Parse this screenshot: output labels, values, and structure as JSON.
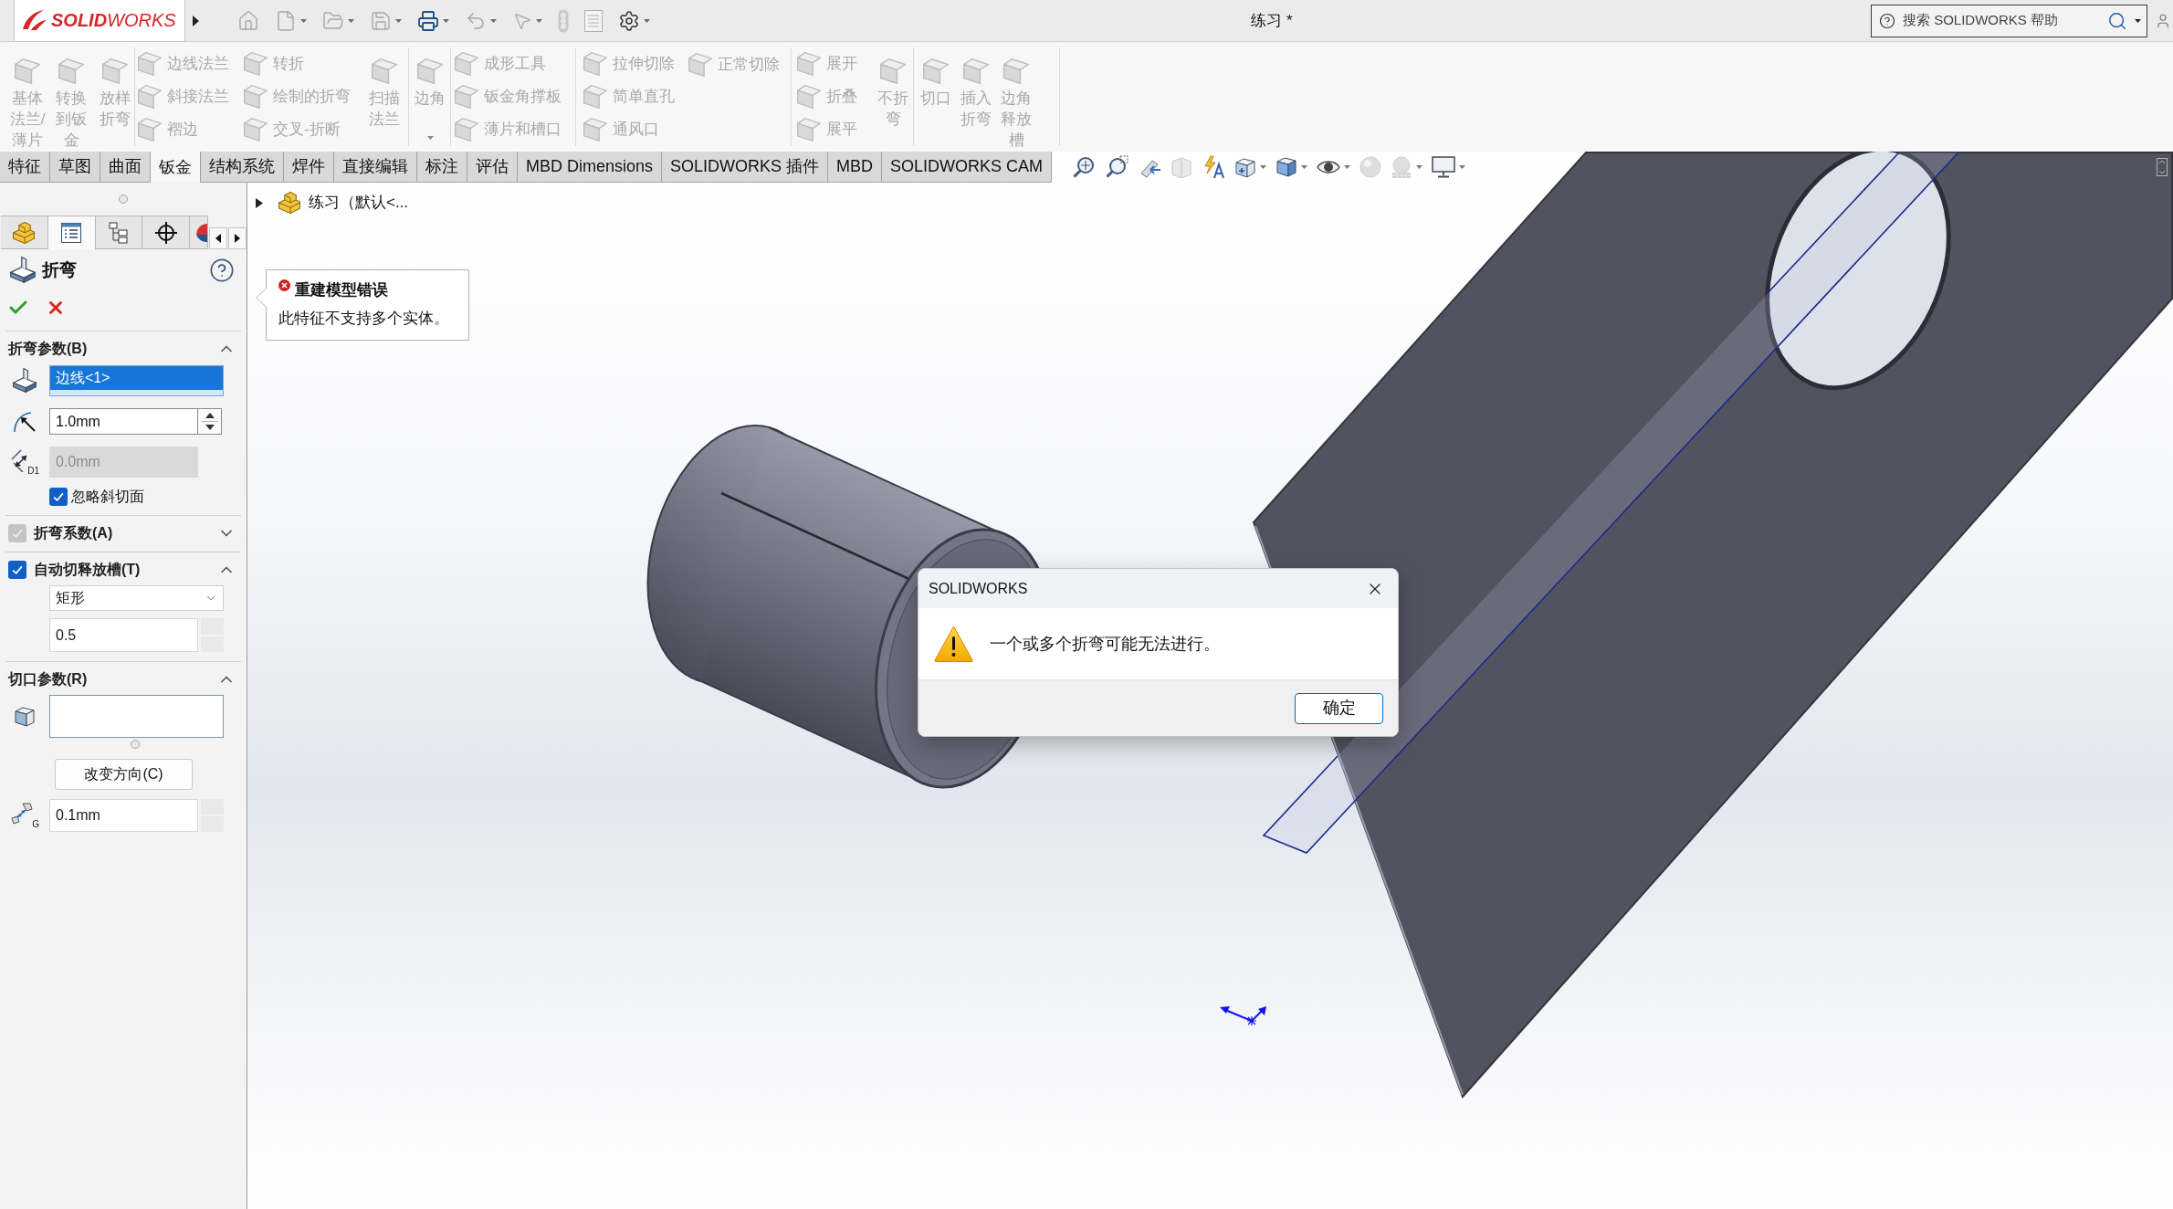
{
  "title_bar": {
    "logo_text": "**SOLID**WORKS",
    "document_title": "练习 *",
    "search": {
      "placeholder": "搜索 SOLIDWORKS 帮助"
    }
  },
  "ribbon": {
    "groups": [
      {
        "items": [
          {
            "kind": "large",
            "label_lines": [
              "基体",
              "法兰/",
              "薄片"
            ],
            "disabled": true
          },
          {
            "kind": "large",
            "label_lines": [
              "转换",
              "到钣",
              "金"
            ],
            "disabled": true
          },
          {
            "kind": "large",
            "label_lines": [
              "放样",
              "折弯"
            ],
            "disabled": true
          }
        ]
      },
      {
        "items": [
          {
            "kind": "stack",
            "items": [
              {
                "label": "边线法兰",
                "disabled": true
              },
              {
                "label": "斜接法兰",
                "disabled": true
              },
              {
                "label": "褶边",
                "disabled": true
              }
            ]
          },
          {
            "kind": "stack",
            "items": [
              {
                "label": "转折",
                "disabled": true
              },
              {
                "label": "绘制的折弯",
                "disabled": true
              },
              {
                "label": "交叉-折断",
                "disabled": true
              }
            ]
          },
          {
            "kind": "large",
            "label_lines": [
              "扫描",
              "法兰"
            ],
            "disabled": true
          }
        ]
      },
      {
        "items": [
          {
            "kind": "large",
            "label_lines": [
              "边角"
            ],
            "disabled": true,
            "dropdown": true
          }
        ]
      },
      {
        "items": [
          {
            "kind": "stack",
            "items": [
              {
                "label": "成形工具",
                "disabled": true
              },
              {
                "label": "钣金角撑板",
                "disabled": true
              },
              {
                "label": "薄片和槽口",
                "disabled": true
              }
            ]
          }
        ]
      },
      {
        "items": [
          {
            "kind": "stack",
            "items": [
              {
                "label": "拉伸切除",
                "disabled": true
              },
              {
                "label": "简单直孔",
                "disabled": true
              },
              {
                "label": "通风口",
                "disabled": true
              }
            ]
          },
          {
            "kind": "stack",
            "items": [
              {
                "label": "正常切除",
                "disabled": true
              }
            ]
          }
        ]
      },
      {
        "items": [
          {
            "kind": "stack",
            "items": [
              {
                "label": "展开",
                "disabled": true
              },
              {
                "label": "折叠",
                "disabled": true
              },
              {
                "label": "展平",
                "disabled": true
              }
            ]
          },
          {
            "kind": "large",
            "label_lines": [
              "不折",
              "弯"
            ],
            "disabled": true
          }
        ]
      },
      {
        "items": [
          {
            "kind": "large",
            "label_lines": [
              "切口"
            ],
            "disabled": true
          },
          {
            "kind": "large",
            "label_lines": [
              "插入",
              "折弯"
            ],
            "disabled": true
          },
          {
            "kind": "large",
            "label_lines": [
              "边角",
              "释放",
              "槽"
            ],
            "disabled": true
          }
        ]
      }
    ]
  },
  "command_tabs": [
    {
      "label": "特征",
      "selected": false
    },
    {
      "label": "草图",
      "selected": false
    },
    {
      "label": "曲面",
      "selected": false
    },
    {
      "label": "钣金",
      "selected": true
    },
    {
      "label": "结构系统",
      "selected": false
    },
    {
      "label": "焊件",
      "selected": false
    },
    {
      "label": "直接编辑",
      "selected": false
    },
    {
      "label": "标注",
      "selected": false
    },
    {
      "label": "评估",
      "selected": false
    },
    {
      "label": "MBD Dimensions",
      "selected": false
    },
    {
      "label": "SOLIDWORKS 插件",
      "selected": false
    },
    {
      "label": "MBD",
      "selected": false
    },
    {
      "label": "SOLIDWORKS CAM",
      "selected": false
    }
  ],
  "property_manager": {
    "tabs": [
      {
        "selected": false
      },
      {
        "selected": true
      },
      {
        "selected": false
      },
      {
        "selected": false
      },
      {
        "selected": false
      }
    ],
    "title": "折弯",
    "sections": [
      {
        "title": "折弯参数(B)",
        "expanded": true,
        "controls": [
          {
            "kind": "edges",
            "items": [
              {
                "label": "边线<1>",
                "selected": true
              }
            ]
          },
          {
            "kind": "radius",
            "value": "1.0mm",
            "spinner": {
              "disabled": false
            }
          },
          {
            "kind": "offset",
            "value": "0.0mm",
            "icon_text": "D1",
            "disabled": true
          },
          {
            "kind": "checkbox",
            "label": "忽略斜切面",
            "checked": true
          }
        ]
      },
      {
        "title": "折弯系数(A)",
        "checkbox": {
          "checked": true,
          "disabled": true
        },
        "expanded": false
      },
      {
        "title": "自动切释放槽(T)",
        "checkbox": {
          "checked": true,
          "disabled": false
        },
        "expanded": true,
        "controls": [
          {
            "kind": "select",
            "value": "矩形"
          },
          {
            "kind": "ratio",
            "value": "0.5",
            "spinner": {
              "disabled": true
            }
          }
        ]
      },
      {
        "title": "切口参数(R)",
        "expanded": true,
        "controls": [
          {
            "kind": "faces"
          },
          {
            "kind": "button",
            "label": "改变方向(C)"
          },
          {
            "kind": "gap",
            "value": "0.1mm",
            "icon_text": "G",
            "spinner": {
              "disabled": true
            }
          }
        ]
      }
    ]
  },
  "feature_tree": {
    "items": [
      {
        "label": "练习（默认<...",
        "expanded": false
      }
    ]
  },
  "error_tooltip": {
    "title": "重建模型错误",
    "message": "此特征不支持多个实体。"
  },
  "dialog": {
    "title": "SOLIDWORKS",
    "message": "一个或多个折弯可能无法进行。",
    "buttons": [
      {
        "label": "确定",
        "default": true
      }
    ]
  }
}
